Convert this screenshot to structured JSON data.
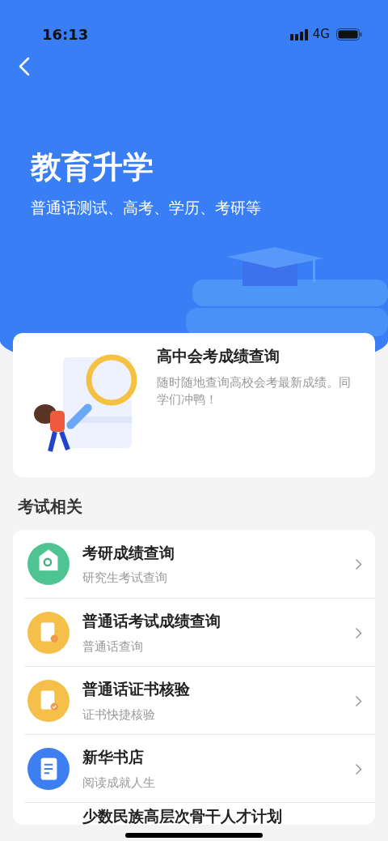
{
  "status_bar": {
    "time": "16:13",
    "network": "4G"
  },
  "header": {
    "title": "教育升学",
    "subtitle": "普通话测试、高考、学历、考研等"
  },
  "featured": {
    "title": "高中会考成绩查询",
    "description": "随时随地查询高校会考最新成绩。同学们冲鸭！"
  },
  "section_title": "考试相关",
  "items": [
    {
      "title": "考研成绩查询",
      "subtitle": "研究生考试查询",
      "kind": "graduate"
    },
    {
      "title": "普通话考试成绩查询",
      "subtitle": "普通话查询",
      "kind": "mandarin-search"
    },
    {
      "title": "普通话证书核验",
      "subtitle": "证书快捷核验",
      "kind": "mandarin-check"
    },
    {
      "title": "新华书店",
      "subtitle": "阅读成就人生",
      "kind": "book"
    },
    {
      "title": "少数民族高层次骨干人才计划",
      "kind": "partial"
    }
  ]
}
